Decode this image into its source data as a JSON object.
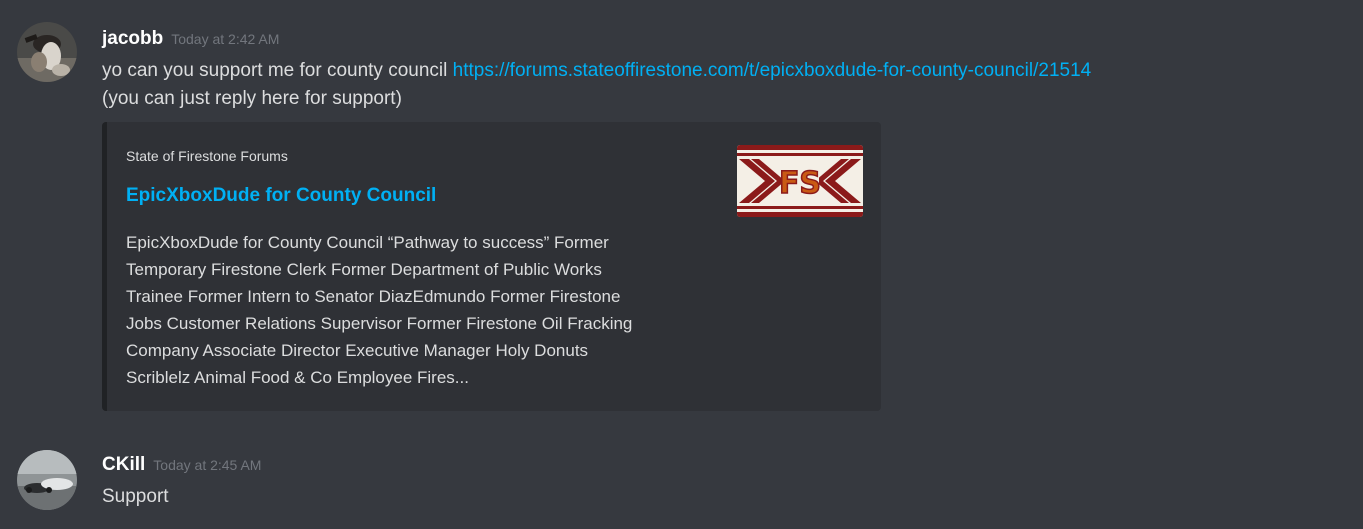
{
  "messages": [
    {
      "username": "jacobb",
      "timestamp": "Today at 2:42 AM",
      "text_before_link": "yo can you support me for county council ",
      "link": "https://forums.stateoffirestone.com/t/epicxboxdude-for-county-council/21514",
      "text_line2": "(you can just reply here for support)",
      "avatar_icon": "avatar-photo-icon",
      "embed": {
        "provider": "State of Firestone Forums",
        "title": "EpicXboxDude for County Council",
        "description_lines": [
          "EpicXboxDude for County Council “Pathway to success” Former",
          "Temporary Firestone Clerk Former Department of Public Works",
          "Trainee Former Intern to Senator DiazEdmundo Former Firestone",
          "Jobs Customer Relations Supervisor Former Firestone Oil Fracking",
          "Company Associate Director Executive Manager Holy Donuts",
          "Scriblelz Animal Food & Co Employee Fires..."
        ],
        "thumbnail_text": "FS",
        "thumbnail_icon": "firestone-logo-icon"
      }
    },
    {
      "username": "CKill",
      "timestamp": "Today at 2:45 AM",
      "text": "Support",
      "avatar_icon": "avatar-photo-icon"
    }
  ],
  "colors": {
    "background": "#36393f",
    "embed_background": "#2f3136",
    "link": "#00b0f4",
    "username": "#ffffff",
    "timestamp": "#72767d",
    "text": "#dcddde",
    "logo_red": "#8b1a1a",
    "logo_orange": "#c95a14"
  }
}
